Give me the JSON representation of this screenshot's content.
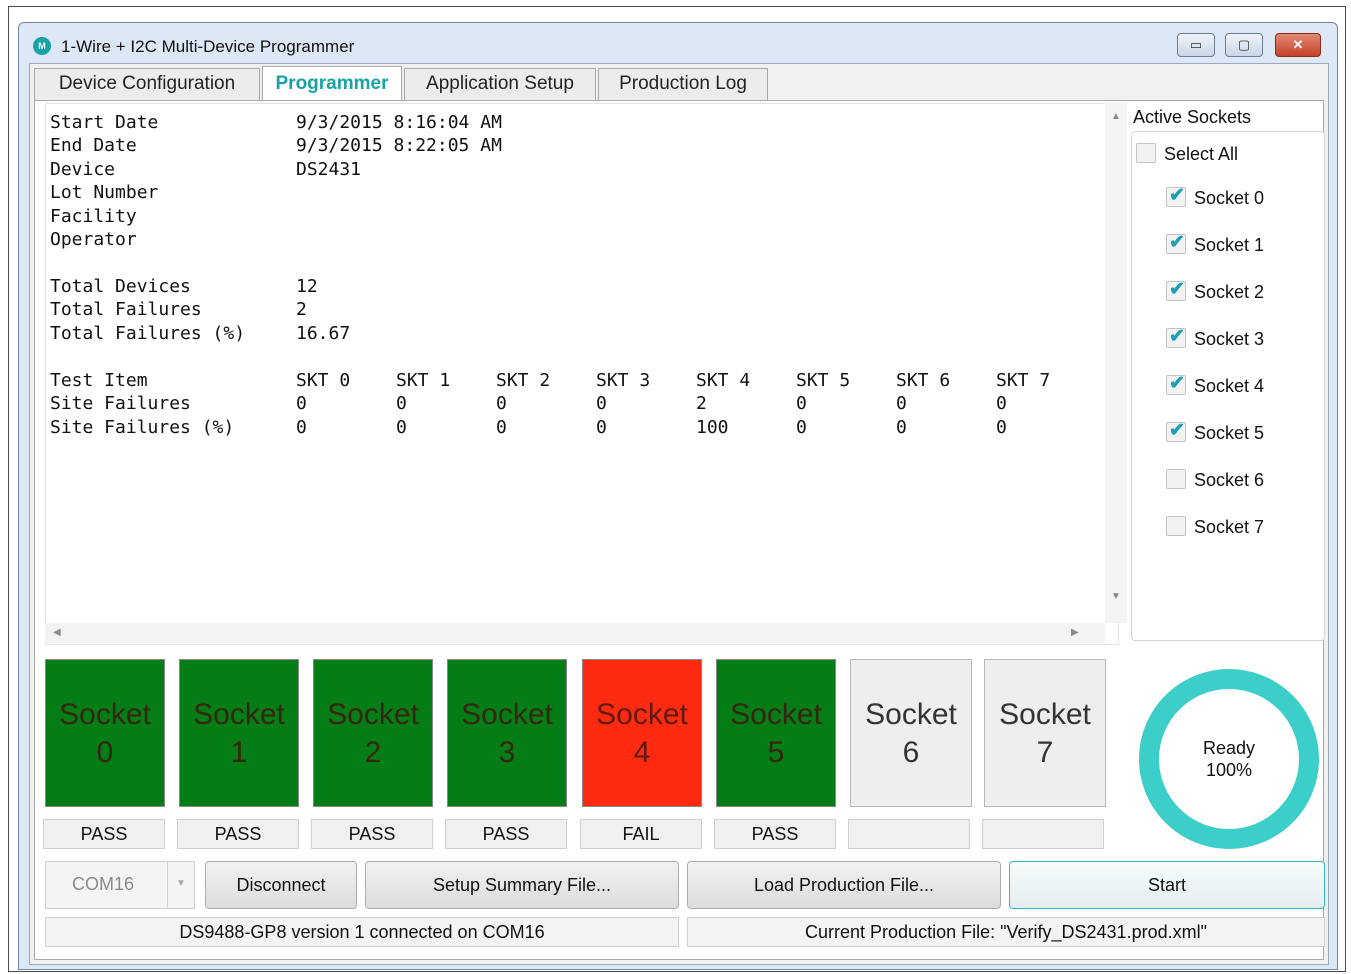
{
  "window": {
    "title": "1-Wire + I2C Multi-Device Programmer",
    "icon": "maxim-logo-icon"
  },
  "title_buttons": {
    "minimize": "▭",
    "maximize": "▢",
    "close": "✕"
  },
  "tabs": [
    {
      "label": "Device Configuration"
    },
    {
      "label": "Programmer",
      "active": true
    },
    {
      "label": "Application Setup"
    },
    {
      "label": "Production Log"
    }
  ],
  "report": {
    "rows": [
      {
        "label": "Start Date",
        "value": "9/3/2015 8:16:04 AM"
      },
      {
        "label": "End Date",
        "value": "9/3/2015 8:22:05 AM"
      },
      {
        "label": "Device",
        "value": "DS2431"
      },
      {
        "label": "Lot Number",
        "value": ""
      },
      {
        "label": "Facility",
        "value": ""
      },
      {
        "label": "Operator",
        "value": ""
      },
      {
        "label": "Total Devices",
        "value": "12"
      },
      {
        "label": "Total Failures",
        "value": "2"
      },
      {
        "label": "Total Failures (%)",
        "value": "16.67"
      }
    ],
    "table": {
      "rows": [
        {
          "label": "Test Item",
          "cells": [
            "SKT 0",
            "SKT 1",
            "SKT 2",
            "SKT 3",
            "SKT 4",
            "SKT 5",
            "SKT 6",
            "SKT 7"
          ]
        },
        {
          "label": "Site Failures",
          "cells": [
            "0",
            "0",
            "0",
            "0",
            "2",
            "0",
            "0",
            "0"
          ]
        },
        {
          "label": "Site Failures (%)",
          "cells": [
            "0",
            "0",
            "0",
            "0",
            "100",
            "0",
            "0",
            "0"
          ]
        }
      ]
    }
  },
  "active_sockets": {
    "label": "Active Sockets",
    "select_all": {
      "label": "Select All",
      "checked": false
    },
    "sockets": [
      {
        "label": "Socket 0",
        "checked": true
      },
      {
        "label": "Socket 1",
        "checked": true
      },
      {
        "label": "Socket 2",
        "checked": true
      },
      {
        "label": "Socket 3",
        "checked": true
      },
      {
        "label": "Socket 4",
        "checked": true
      },
      {
        "label": "Socket 5",
        "checked": true
      },
      {
        "label": "Socket 6",
        "checked": false
      },
      {
        "label": "Socket 7",
        "checked": false
      }
    ]
  },
  "socket_tiles": [
    {
      "title": "Socket",
      "number": "0",
      "state": "pass",
      "result": "PASS"
    },
    {
      "title": "Socket",
      "number": "1",
      "state": "pass",
      "result": "PASS"
    },
    {
      "title": "Socket",
      "number": "2",
      "state": "pass",
      "result": "PASS"
    },
    {
      "title": "Socket",
      "number": "3",
      "state": "pass",
      "result": "PASS"
    },
    {
      "title": "Socket",
      "number": "4",
      "state": "fail",
      "result": "FAIL"
    },
    {
      "title": "Socket",
      "number": "5",
      "state": "pass",
      "result": "PASS"
    },
    {
      "title": "Socket",
      "number": "6",
      "state": "idle",
      "result": ""
    },
    {
      "title": "Socket",
      "number": "7",
      "state": "idle",
      "result": ""
    }
  ],
  "progress": {
    "status": "Ready",
    "percent_label": "100%",
    "fraction": 1.0,
    "color": "#3ccfca"
  },
  "colors": {
    "accent": "#17a2a8",
    "pass": "#047d17",
    "fail": "#ff2a0f"
  },
  "controls": {
    "port": "COM16",
    "disconnect": "Disconnect",
    "setup_summary": "Setup Summary File...",
    "load_production": "Load Production File...",
    "start": "Start"
  },
  "statusbar": {
    "connection": "DS9488-GP8 version 1 connected on COM16",
    "production_file": "Current Production File: \"Verify_DS2431.prod.xml\""
  }
}
